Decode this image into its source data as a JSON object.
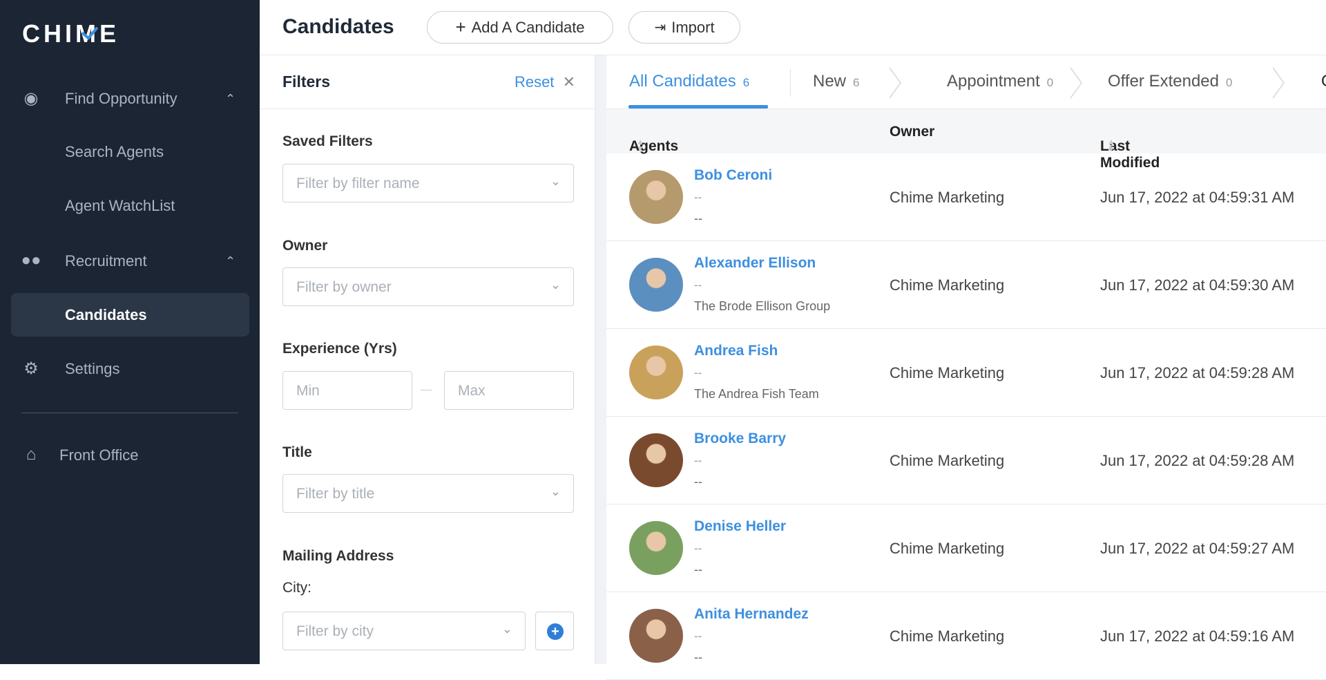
{
  "sidebar": {
    "logo": "CHIME",
    "items": [
      {
        "label": "Find Opportunity",
        "icon": "search-person-icon"
      },
      {
        "label": "Search Agents"
      },
      {
        "label": "Agent WatchList"
      },
      {
        "label": "Recruitment",
        "icon": "users-icon"
      },
      {
        "label": "Candidates",
        "active": true
      },
      {
        "label": "Settings",
        "icon": "gear-icon"
      },
      {
        "label": "Front Office",
        "icon": "house-icon"
      }
    ]
  },
  "header": {
    "title": "Candidates",
    "add_label": "Add A Candidate",
    "import_label": "Import"
  },
  "filters": {
    "title": "Filters",
    "reset": "Reset",
    "saved_label": "Saved Filters",
    "saved_ph": "Filter by filter name",
    "owner_label": "Owner",
    "owner_ph": "Filter by owner",
    "exp_label": "Experience (Yrs)",
    "min_ph": "Min",
    "max_ph": "Max",
    "title_label": "Title",
    "title_ph": "Filter by title",
    "mail_label": "Mailing Address",
    "city_label": "City:",
    "city_ph": "Filter by city"
  },
  "tabs": [
    {
      "label": "All Candidates",
      "count": "6"
    },
    {
      "label": "New",
      "count": "6"
    },
    {
      "label": "Appointment",
      "count": "0"
    },
    {
      "label": "Offer Extended",
      "count": "0"
    },
    {
      "label": "O"
    }
  ],
  "columns": {
    "agents": "Agents",
    "owner": "Owner",
    "modified": "Last Modified"
  },
  "rows": [
    {
      "name": "Bob Ceroni",
      "line2": "--",
      "line3": "--",
      "owner": "Chime Marketing",
      "modified": "Jun 17, 2022 at 04:59:31 AM",
      "avatar": "#b59a6e"
    },
    {
      "name": "Alexander Ellison",
      "line2": "--",
      "line3": "The Brode Ellison Group",
      "owner": "Chime Marketing",
      "modified": "Jun 17, 2022 at 04:59:30 AM",
      "avatar": "#5b8fc0"
    },
    {
      "name": "Andrea Fish",
      "line2": "--",
      "line3": "The Andrea Fish Team",
      "owner": "Chime Marketing",
      "modified": "Jun 17, 2022 at 04:59:28 AM",
      "avatar": "#c9a15a"
    },
    {
      "name": "Brooke Barry",
      "line2": "--",
      "line3": "--",
      "owner": "Chime Marketing",
      "modified": "Jun 17, 2022 at 04:59:28 AM",
      "avatar": "#7a4a2e"
    },
    {
      "name": "Denise Heller",
      "line2": "--",
      "line3": "--",
      "owner": "Chime Marketing",
      "modified": "Jun 17, 2022 at 04:59:27 AM",
      "avatar": "#7aa060"
    },
    {
      "name": "Anita Hernandez",
      "line2": "--",
      "line3": "--",
      "owner": "Chime Marketing",
      "modified": "Jun 17, 2022 at 04:59:16 AM",
      "avatar": "#8a6048"
    }
  ]
}
